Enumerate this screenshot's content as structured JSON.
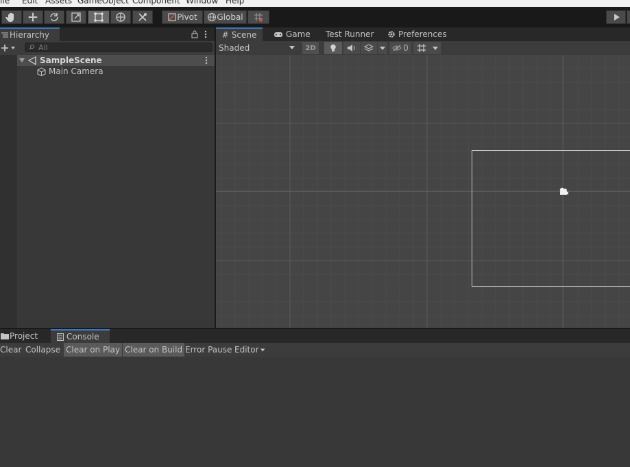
{
  "menu": [
    "File",
    "Edit",
    "Assets",
    "GameObject",
    "Component",
    "Window",
    "Help"
  ],
  "toolbar": {
    "pivot_label": "Pivot",
    "global_label": "Global"
  },
  "hierarchy": {
    "tab_label": "Hierarchy",
    "search_placeholder": "All",
    "scene_name": "SampleScene",
    "items": [
      "Main Camera"
    ]
  },
  "scene_view": {
    "tabs": [
      "Scene",
      "Game",
      "Test Runner",
      "Preferences"
    ],
    "shading_mode": "Shaded",
    "mode_2d_label": "2D",
    "hidden_count": "0"
  },
  "console": {
    "tabs": [
      "Project",
      "Console"
    ],
    "buttons": [
      "Clear",
      "Collapse",
      "Clear on Play",
      "Clear on Build",
      "Error Pause",
      "Editor"
    ]
  },
  "colors": {
    "accent": "#3a79bb",
    "toolbar_bg": "#191919",
    "panel_bg": "#383838",
    "scene_bg": "#454545"
  }
}
